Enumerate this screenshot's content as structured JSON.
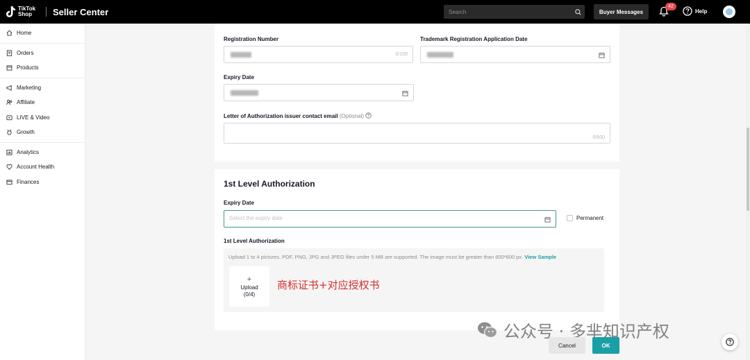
{
  "header": {
    "logo_text": "TikTok Shop",
    "title": "Seller Center",
    "search_placeholder": "Search",
    "buyer_messages_label": "Buyer Messages",
    "notification_count": "42",
    "help_label": "Help",
    "icons": [
      "tiktok-logo",
      "search-icon",
      "bell-icon",
      "help-circle-icon",
      "avatar"
    ]
  },
  "sidebar": {
    "groups": [
      [
        {
          "label": "Home",
          "icon": "home-icon"
        }
      ],
      [
        {
          "label": "Orders",
          "icon": "orders-icon"
        },
        {
          "label": "Products",
          "icon": "products-icon"
        }
      ],
      [
        {
          "label": "Marketing",
          "icon": "megaphone-icon"
        },
        {
          "label": "Affiliate",
          "icon": "affiliate-icon"
        },
        {
          "label": "LIVE & Video",
          "icon": "video-icon"
        },
        {
          "label": "Growth",
          "icon": "medal-icon"
        }
      ],
      [
        {
          "label": "Analytics",
          "icon": "chart-icon"
        },
        {
          "label": "Account Health",
          "icon": "health-icon"
        },
        {
          "label": "Finances",
          "icon": "wallet-icon"
        }
      ]
    ]
  },
  "trademark_card": {
    "registration_number_label": "Registration Number",
    "registration_number_counter": "0/100",
    "application_date_label": "Trademark Registration Application Date",
    "expiry_date_label": "Expiry Date",
    "loa_email_label": "Letter of Authorization issuer contact email",
    "loa_email_optional": "(Optional)",
    "loa_email_counter": "0/500"
  },
  "authorization_card": {
    "title": "1st Level Authorization",
    "expiry_date_label": "Expiry Date",
    "expiry_date_placeholder": "Select the expiry date",
    "permanent_label": "Permanent",
    "upload_section_label": "1st Level Authorization",
    "upload_hint": "Upload 1 to 4 pictures. PDF, PNG, JPG and JPEG files under 5 MB are supported. The image must be greater than 600*600 px.",
    "view_sample_label": "View Sample",
    "upload_label": "Upload",
    "upload_count": "(0/4)",
    "annotation": "商标证书+对应授权书"
  },
  "footer": {
    "cancel_label": "Cancel",
    "ok_label": "OK"
  },
  "watermark": {
    "text": "公众号 · 多芈知识产权"
  },
  "colors": {
    "accent": "#1a9fa6",
    "badge": "#e3484b",
    "annotation": "#d32f2f"
  }
}
